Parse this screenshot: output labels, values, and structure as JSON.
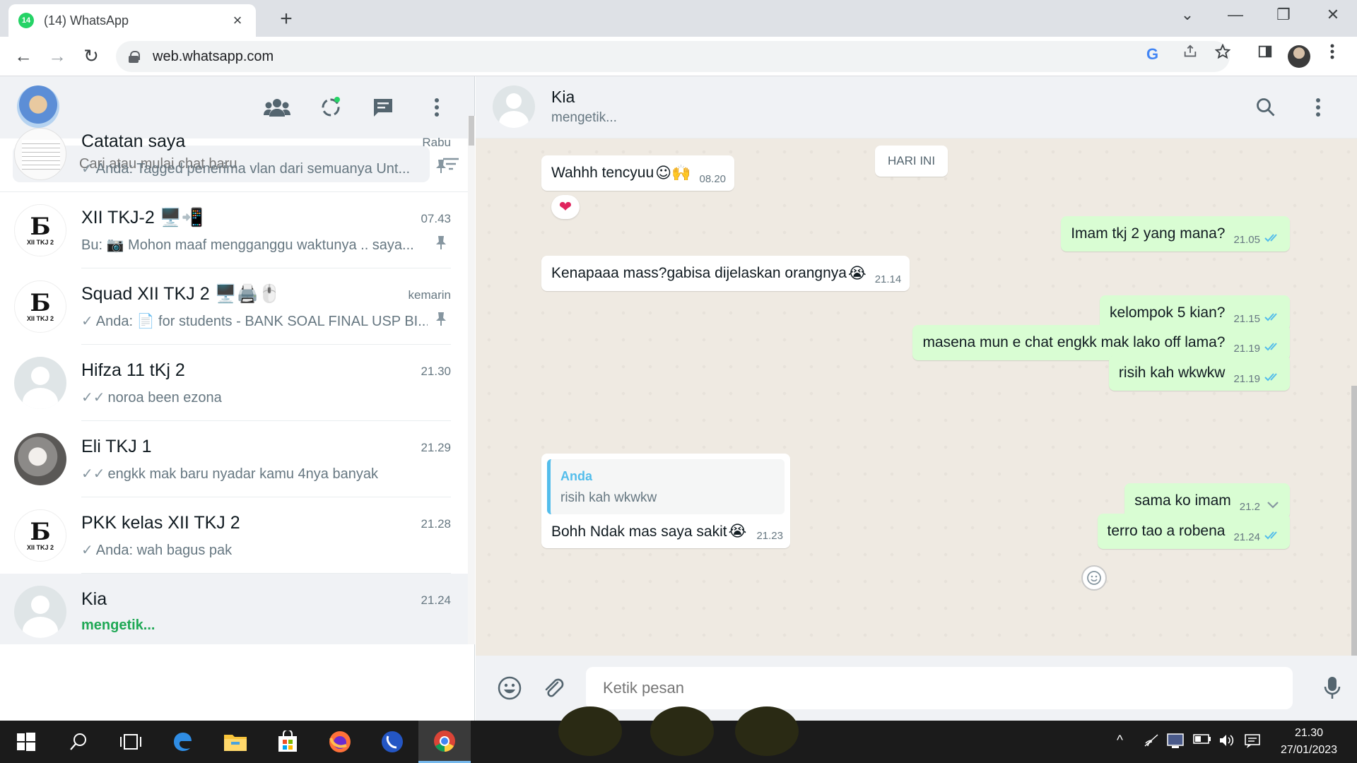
{
  "browser": {
    "tab_title": "(14) WhatsApp",
    "tab_badge": "14",
    "tab_close": "×",
    "new_tab": "+",
    "url": "web.whatsapp.com",
    "window_controls": [
      "⌄",
      "—",
      "❐",
      "✕"
    ],
    "nav": {
      "back": "←",
      "forward": "→",
      "reload": "↻"
    },
    "google_icon_label": "G"
  },
  "left": {
    "search_placeholder": "Cari atau mulai chat baru",
    "chats": [
      {
        "name": "Catatan saya",
        "time": "Rabu",
        "check": "✓",
        "preview": "Anda: Tagged penerima vlan dari semuanya  Unt...",
        "pinned": true,
        "avatar": "notes"
      },
      {
        "name": "XII TKJ-2 🖥️📲",
        "time": "07.43",
        "check": "",
        "preview": "Bu: 📷 Mohon maaf mengganggu waktunya ..  saya...",
        "pinned": true,
        "avatar": "logo"
      },
      {
        "name": "Squad XII TKJ 2  🖥️🖨️🖱️",
        "time": "kemarin",
        "check": "✓",
        "preview": "Anda: 📄 for students - BANK SOAL FINAL USP BI...",
        "pinned": true,
        "avatar": "logo"
      },
      {
        "name": "Hifza 11 tKj 2",
        "time": "21.30",
        "check": "✓✓",
        "preview": "noroa been ezona",
        "pinned": false,
        "avatar": "default"
      },
      {
        "name": "Eli TKJ 1",
        "time": "21.29",
        "check": "✓✓",
        "preview": "engkk mak baru nyadar kamu 4nya banyak",
        "pinned": false,
        "avatar": "cat"
      },
      {
        "name": "PKK kelas XII TKJ 2",
        "time": "21.28",
        "check": "✓",
        "preview": "Anda: wah bagus pak",
        "pinned": false,
        "avatar": "logo"
      },
      {
        "name": "Kia",
        "time": "21.24",
        "check": "",
        "preview": "mengetik...",
        "pinned": false,
        "avatar": "default",
        "active": true,
        "typing": true
      }
    ],
    "logo_mark": "Ƃ",
    "logo_sub": "XII TKJ 2"
  },
  "conversation": {
    "name": "Kia",
    "status": "mengetik...",
    "date_chip": "HARI INI",
    "messages": [
      {
        "dir": "in",
        "text": "Wahhh tencyuu",
        "emoji": "☺🙌",
        "time": "08.20"
      },
      {
        "dir": "out",
        "text": "Imam tkj 2 yang mana?",
        "time": "21.05",
        "read": true
      },
      {
        "dir": "in",
        "text": "Kenapaaa mass?gabisa dijelaskan orangnya",
        "emoji": "😭",
        "time": "21.14"
      },
      {
        "dir": "out",
        "text": "kelompok 5 kian?",
        "time": "21.15",
        "read": true
      },
      {
        "dir": "out",
        "text": "masena mun e chat engkk mak lako off lama?",
        "time": "21.19",
        "read": true
      },
      {
        "dir": "out",
        "text": "risih kah wkwkw",
        "time": "21.19",
        "read": true
      },
      {
        "dir": "out",
        "text": "sama ko imam",
        "time": "21.2",
        "read": false
      },
      {
        "dir": "out",
        "text": "terro tao a robena",
        "time": "21.24",
        "read": true
      }
    ],
    "reaction": "❤",
    "reply": {
      "author": "Anda",
      "quoted": "risih kah wkwkw",
      "text": "Bohh Ndak mas saya sakit",
      "emoji": "😭",
      "time": "21.23"
    },
    "compose_placeholder": "Ketik pesan"
  },
  "taskbar": {
    "clock_time": "21.30",
    "clock_date": "27/01/2023",
    "tray_up": "^"
  },
  "colors": {
    "accent_green": "#25d366",
    "outgoing_bubble": "#d9fdd3",
    "read_ticks": "#53bdeb",
    "header_bg": "#f0f2f5",
    "chat_bg": "#efeae2"
  }
}
